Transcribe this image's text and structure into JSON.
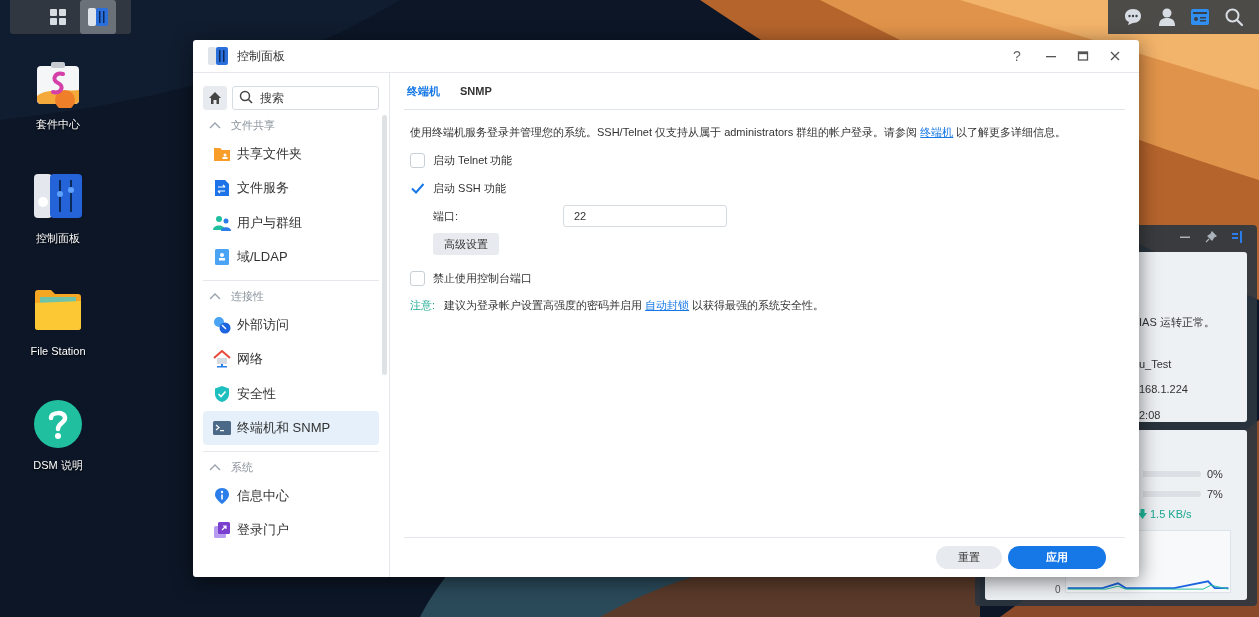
{
  "taskbar": {
    "apps": [
      {
        "kind": "main-menu",
        "selected": false
      },
      {
        "kind": "control-panel",
        "selected": true
      }
    ],
    "tray": [
      {
        "kind": "chat",
        "selected": false
      },
      {
        "kind": "user",
        "selected": false
      },
      {
        "kind": "widgets",
        "selected": true
      },
      {
        "kind": "search",
        "selected": false
      }
    ]
  },
  "desktop": [
    {
      "label": "套件中心",
      "kind": "package"
    },
    {
      "label": "控制面板",
      "kind": "control-panel"
    },
    {
      "label": "File Station",
      "kind": "folder"
    },
    {
      "label": "DSM 说明",
      "kind": "help"
    }
  ],
  "widget": {
    "status": "IAS 运转正常。",
    "info": [
      "u_Test",
      "168.1.224",
      "2:08"
    ],
    "meters": [
      {
        "reading": "0%"
      },
      {
        "reading": "7%"
      }
    ],
    "download": "1.5 KB/s",
    "chart_axis": "0"
  },
  "window": {
    "title": "控制面板",
    "help": "?",
    "search": {
      "placeholder": "搜索"
    },
    "sidebar": [
      {
        "title": "文件共享",
        "expanded": true,
        "items": [
          {
            "label": "共享文件夹",
            "kind": "shared-folder",
            "selected": false
          },
          {
            "label": "文件服务",
            "kind": "file-services",
            "selected": false
          },
          {
            "label": "用户与群组",
            "kind": "users",
            "selected": false
          },
          {
            "label": "域/LDAP",
            "kind": "ldap",
            "selected": false
          }
        ]
      },
      {
        "title": "连接性",
        "expanded": true,
        "items": [
          {
            "label": "外部访问",
            "kind": "external",
            "selected": false
          },
          {
            "label": "网络",
            "kind": "network",
            "selected": false
          },
          {
            "label": "安全性",
            "kind": "security",
            "selected": false
          },
          {
            "label": "终端机和 SNMP",
            "kind": "terminal",
            "selected": true
          }
        ]
      },
      {
        "title": "系统",
        "expanded": true,
        "items": [
          {
            "label": "信息中心",
            "kind": "info",
            "selected": false
          },
          {
            "label": "登录门户",
            "kind": "portal",
            "selected": false
          }
        ]
      }
    ],
    "tabs": [
      {
        "label": "终端机",
        "selected": true
      },
      {
        "label": "SNMP",
        "selected": false
      }
    ],
    "description": {
      "before": "使用终端机服务登录并管理您的系统。SSH/Telnet 仅支持从属于 administrators 群组的帐户登录。请参阅 ",
      "link": "终端机",
      "after": " 以了解更多详细信息。"
    },
    "options": [
      {
        "kind": "checkbox",
        "label": "启动 Telnet 功能",
        "checked": false
      },
      {
        "kind": "checkbox",
        "label": "启动 SSH 功能",
        "checked": true
      },
      {
        "kind": "field",
        "label": "端口:",
        "value": "22"
      },
      {
        "kind": "button",
        "label": "高级设置"
      },
      {
        "kind": "checkbox",
        "label": "禁止使用控制台端口",
        "checked": false
      }
    ],
    "note": {
      "label": "注意:",
      "before": "建议为登录帐户设置高强度的密码并启用 ",
      "link": "自动封锁",
      "after": " 以获得最强的系统安全性。"
    },
    "buttons": [
      {
        "label": "重置",
        "kind": "secondary"
      },
      {
        "label": "应用",
        "kind": "primary"
      }
    ]
  }
}
